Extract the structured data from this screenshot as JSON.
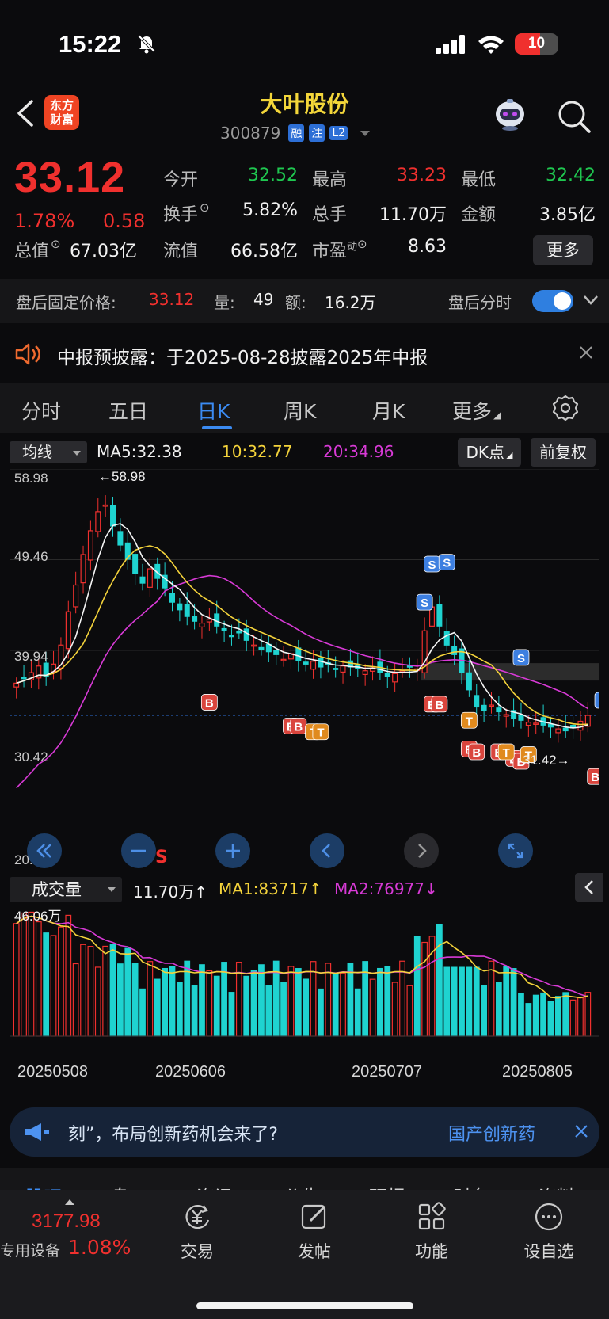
{
  "status_bar": {
    "time": "15:22",
    "battery": "10"
  },
  "header": {
    "logo_line1": "东方",
    "logo_line2": "财富",
    "stock_name": "大叶股份",
    "stock_code": "300879",
    "tags": [
      "融",
      "注",
      "L2"
    ]
  },
  "quote": {
    "price": "33.12",
    "change_pct": "1.78%",
    "change_amt": "0.58",
    "rows": [
      [
        {
          "label": "今开",
          "value": "32.52",
          "color": "green"
        },
        {
          "label": "最高",
          "value": "33.23",
          "color": "red"
        },
        {
          "label": "最低",
          "value": "32.42",
          "color": "green"
        }
      ],
      [
        {
          "label": "换手",
          "value": "5.82%",
          "color": "white"
        },
        {
          "label": "总手",
          "value": "11.70万",
          "color": "white"
        },
        {
          "label": "金额",
          "value": "3.85亿",
          "color": "white"
        }
      ],
      [
        {
          "label": "总值",
          "value": "67.03亿",
          "color": "white"
        },
        {
          "label": "流值",
          "value": "66.58亿",
          "color": "white"
        },
        {
          "label": "市盈",
          "label_sup": "动",
          "value": "8.63",
          "color": "white"
        }
      ]
    ],
    "more_label": "更多"
  },
  "after_hours": {
    "label": "盘后固定价格:",
    "price": "33.12",
    "volume_label": "量:",
    "volume": "49",
    "amount_label": "额:",
    "amount": "16.2万",
    "timeshare_label": "盘后分时",
    "toggle_on": true
  },
  "notice": {
    "text": "中报预披露：于2025-08-28披露2025年中报"
  },
  "tabs": [
    "分时",
    "五日",
    "日K",
    "周K",
    "月K",
    "更多"
  ],
  "active_tab": "日K",
  "chart_header": {
    "ma_select": "均线",
    "ma5": "MA5:32.38",
    "ma10": "10:32.77",
    "ma20": "20:34.96",
    "dk_label": "DK点",
    "adjust_label": "前复权"
  },
  "chart_data": {
    "type": "candlestick",
    "y_ticks": [
      "58.98",
      "49.46",
      "39.94",
      "30.42",
      "20.90"
    ],
    "y_range": [
      20.9,
      58.98
    ],
    "annotations": {
      "high": "58.98",
      "low": "31.42"
    },
    "marker_labels": {
      "buy": "B",
      "sell": "S",
      "t": "T",
      "nav_s": "S"
    },
    "closes": [
      36.5,
      37.0,
      37.6,
      38.3,
      37.2,
      38.5,
      40.5,
      44.0,
      46.8,
      50.0,
      52.5,
      54.5,
      55.2,
      53.0,
      51.0,
      49.5,
      48.0,
      47.0,
      48.5,
      47.5,
      46.5,
      45.0,
      44.2,
      43.5,
      43.0,
      42.8,
      43.2,
      42.5,
      42.0,
      41.5,
      41.8,
      41.0,
      40.5,
      40.0,
      39.8,
      39.5,
      39.0,
      39.6,
      38.9,
      38.5,
      38.8,
      38.2,
      38.5,
      38.0,
      38.3,
      38.2,
      38.0,
      37.8,
      38.1,
      37.6,
      37.2,
      37.5,
      37.8,
      38.2,
      38.0,
      42.0,
      44.5,
      42.5,
      40.5,
      39.5,
      37.6,
      35.8,
      34.0,
      33.6,
      34.2,
      33.5,
      33.2,
      32.8,
      32.6,
      32.4,
      32.3,
      32.1,
      31.9,
      31.7,
      31.5,
      31.8,
      32.5,
      33.12
    ],
    "volume": {
      "title": "成交量",
      "value": "11.70万",
      "ma1": "MA1:83717",
      "ma2": "MA2:76977",
      "max_label": "46.06万",
      "dates": [
        "20250508",
        "20250606",
        "20250707",
        "20250805"
      ]
    }
  },
  "ad": {
    "text": "刻”，布局创新药机会来了?",
    "link": "国产创新药"
  },
  "sub_tabs": [
    "股吧",
    "盘口",
    "资讯",
    "公告",
    "研报",
    "财务",
    "资料"
  ],
  "bottom_nav": {
    "index_value": "3177.98",
    "index_label": "专用设备",
    "index_pct": "1.08%",
    "items": [
      {
        "label": "交易",
        "icon": "yen-exchange-icon"
      },
      {
        "label": "发帖",
        "icon": "edit-icon"
      },
      {
        "label": "功能",
        "icon": "grid-icon"
      },
      {
        "label": "设自选",
        "icon": "more-dots-icon"
      }
    ]
  }
}
